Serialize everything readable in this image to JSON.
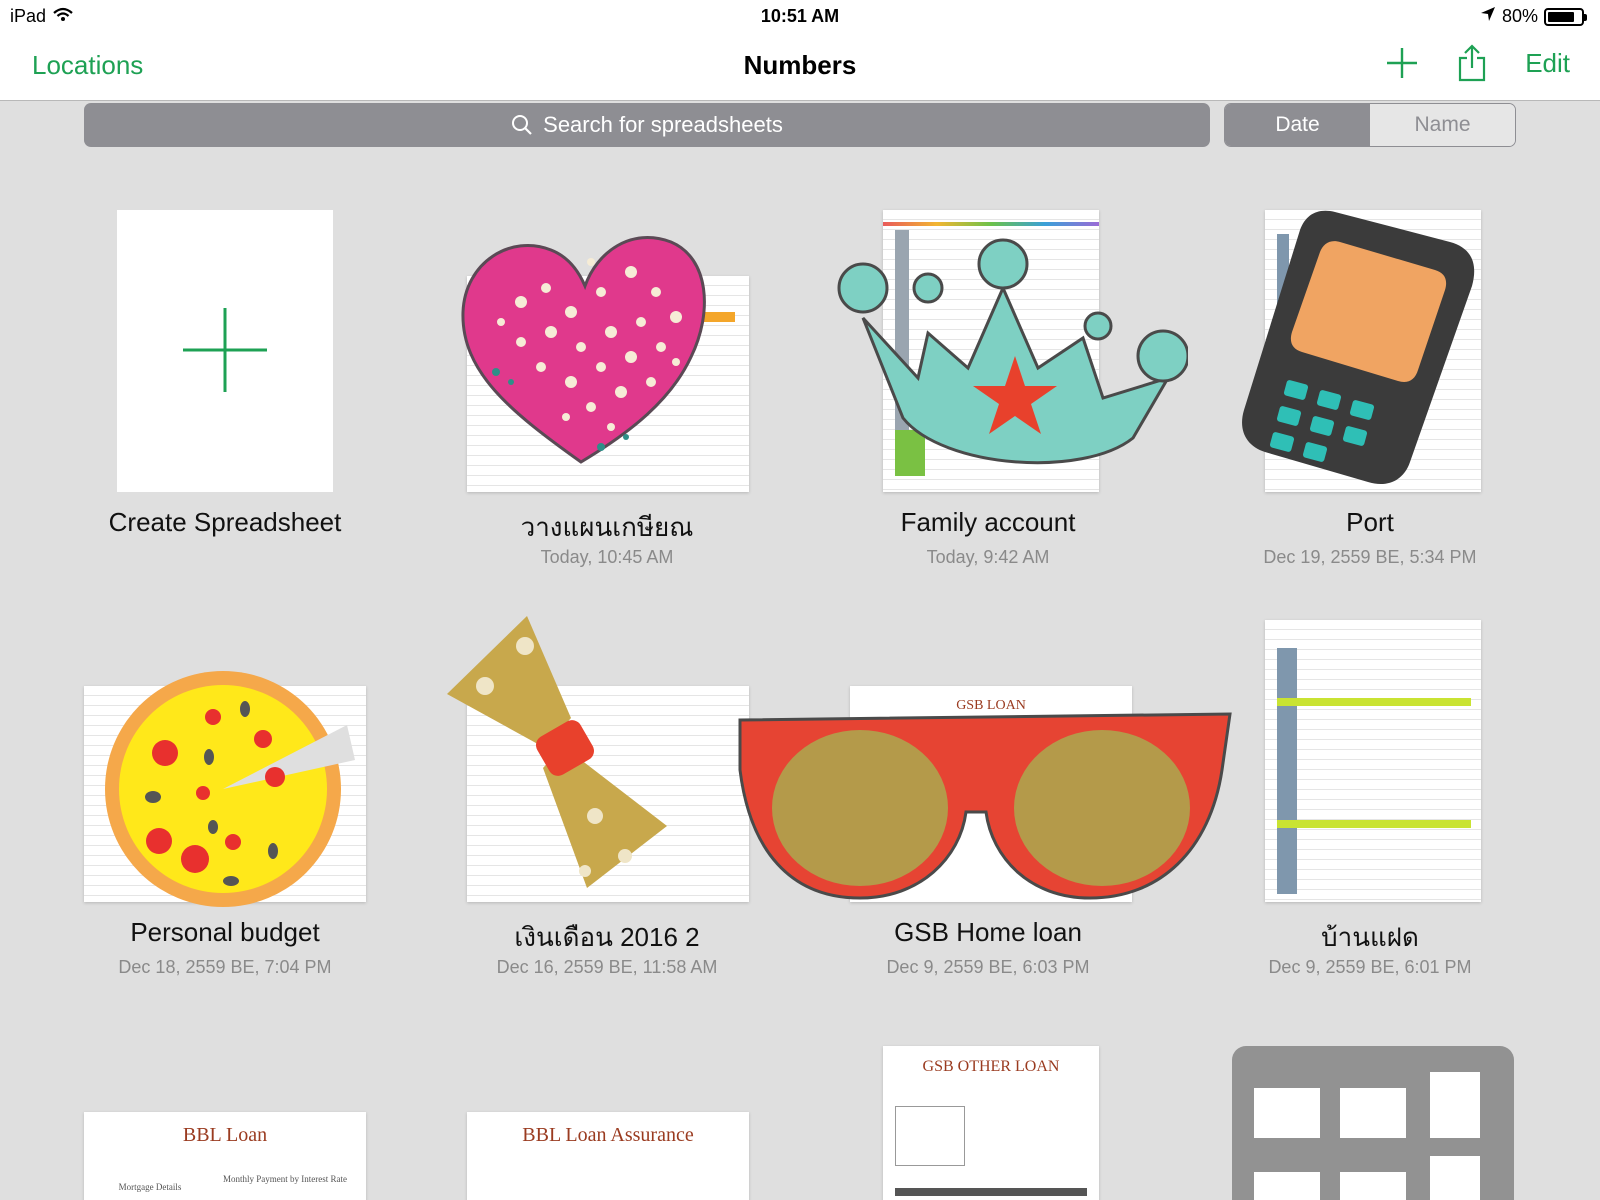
{
  "status_bar": {
    "device": "iPad",
    "time": "10:51 AM",
    "battery": "80%",
    "battery_level": 0.8
  },
  "nav": {
    "back_label": "Locations",
    "title": "Numbers",
    "edit_label": "Edit"
  },
  "search": {
    "placeholder": "Search for spreadsheets"
  },
  "sort": {
    "options": [
      "Date",
      "Name"
    ],
    "selected": "Date"
  },
  "documents": [
    {
      "name": "Create Spreadsheet",
      "date": ""
    },
    {
      "name": "วางแผนเกษียณ",
      "date": "Today, 10:45 AM"
    },
    {
      "name": "Family account",
      "date": "Today, 9:42 AM"
    },
    {
      "name": "Port",
      "date": "Dec 19, 2559 BE, 5:34 PM"
    },
    {
      "name": "Personal budget",
      "date": "Dec 18, 2559 BE, 7:04 PM"
    },
    {
      "name": "เงินเดือน 2016 2",
      "date": "Dec 16, 2559 BE, 11:58 AM"
    },
    {
      "name": "GSB Home loan",
      "date": "Dec 9, 2559 BE, 6:03 PM"
    },
    {
      "name": "บ้านแฝด",
      "date": "Dec 9, 2559 BE, 6:01 PM"
    }
  ],
  "partial_thumbnails": {
    "bbl_loan_title": "BBL Loan",
    "bbl_loan_assurance_title": "BBL Loan Assurance",
    "gsb_other_loan_title": "GSB OTHER LOAN",
    "gsb_loan_title": "GSB LOAN",
    "mortgage_details": "Mortgage Details",
    "monthly_payment": "Monthly Payment by Interest Rate"
  },
  "colors": {
    "accent_green": "#1ea154",
    "segment_gray": "#8e8e93",
    "background": "#dfdfdf"
  }
}
